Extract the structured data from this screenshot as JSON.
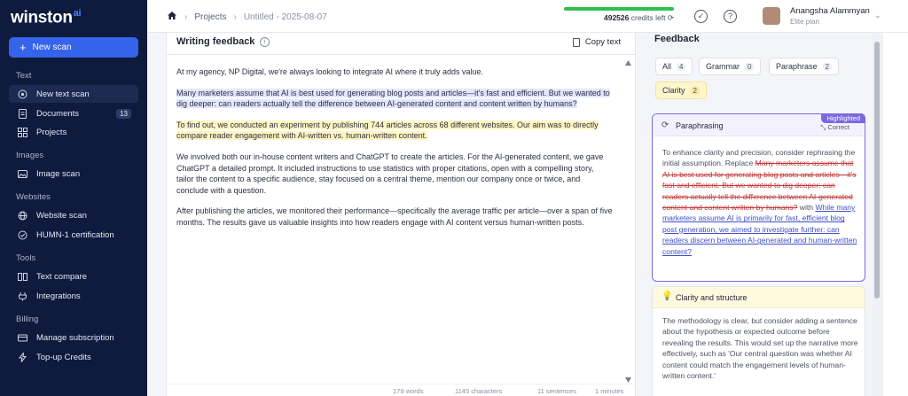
{
  "app": {
    "logo": "winston",
    "logo_ai": "ai"
  },
  "sidebar": {
    "new_scan": "New scan",
    "sections": {
      "text": "Text",
      "images": "Images",
      "websites": "Websites",
      "tools": "Tools",
      "billing": "Billing"
    },
    "items": {
      "new_text_scan": "New text scan",
      "documents": "Documents",
      "documents_count": "13",
      "projects": "Projects",
      "image_scan": "Image scan",
      "website_scan": "Website scan",
      "humn_cert": "HUMN-1 certification",
      "text_compare": "Text compare",
      "integrations": "Integrations",
      "manage_subscription": "Manage subscription",
      "topup": "Top-up Credits"
    }
  },
  "topbar": {
    "breadcrumb_projects": "Projects",
    "breadcrumb_doc": "Untitled - 2025-08-07",
    "credits_value": "492526",
    "credits_suffix": "credits left",
    "credits_fraction": 1.0,
    "user_name": "Anangsha Alammyan",
    "user_plan": "Elite plan"
  },
  "writing": {
    "title": "Writing feedback",
    "copy": "Copy text",
    "paragraphs": {
      "p1": "At my agency, NP Digital, we're always looking to integrate AI where it truly adds value.",
      "p2": "Many marketers assume that AI is best used for generating blog posts and articles—it's fast and efficient. But we wanted to dig deeper: can readers actually tell the difference between AI-generated content and content written by humans?",
      "p3": "To find out, we conducted an experiment by publishing 744 articles across 68 different websites. Our aim was to directly compare reader engagement with AI-written vs. human-written content.",
      "p4": "We involved both our in-house content writers and ChatGPT to create the articles. For the AI-generated content, we gave ChatGPT a detailed prompt. It included instructions to use statistics with proper citations, open with a compelling story, tailor the content to a specific audience, stay focused on a central theme, mention our company once or twice, and conclude with a question.",
      "p5": "After publishing the articles, we monitored their performance—specifically the average traffic per article—over a span of five months. The results gave us valuable insights into how readers engage with AI content versus human-written posts."
    },
    "stats": {
      "words": "179 words",
      "characters": "1145 characters",
      "sentences": "11 sentences",
      "minutes": "1 minutes"
    }
  },
  "feedback": {
    "title": "Feedback",
    "chips": {
      "all": "All",
      "all_n": "4",
      "grammar": "Grammar",
      "grammar_n": "0",
      "paraphrase": "Paraphrase",
      "paraphrase_n": "2",
      "clarity": "Clarity",
      "clarity_n": "2"
    },
    "card1": {
      "badge": "Highlighted",
      "title": "Paraphrasing",
      "action": "Correct",
      "intro": "To enhance clarity and precision, consider rephrasing the initial assumption. Replace ",
      "removed": "Many marketers assume that AI is best used for generating blog posts and articles—it's fast and efficient. But we wanted to dig deeper: can readers actually tell the difference between AI-generated content and content written by humans?",
      "with": " with ",
      "added": "While many marketers assume AI is primarily for fast, efficient blog post generation, we aimed to investigate further: can readers discern between AI-generated and human-written content?"
    },
    "card2": {
      "title": "Clarity and structure",
      "body": "The methodology is clear, but consider adding a sentence about the hypothesis or expected outcome before revealing the results. This would set up the narrative more effectively, such as 'Our central question was whether AI content could match the engagement levels of human-written content.'"
    }
  }
}
